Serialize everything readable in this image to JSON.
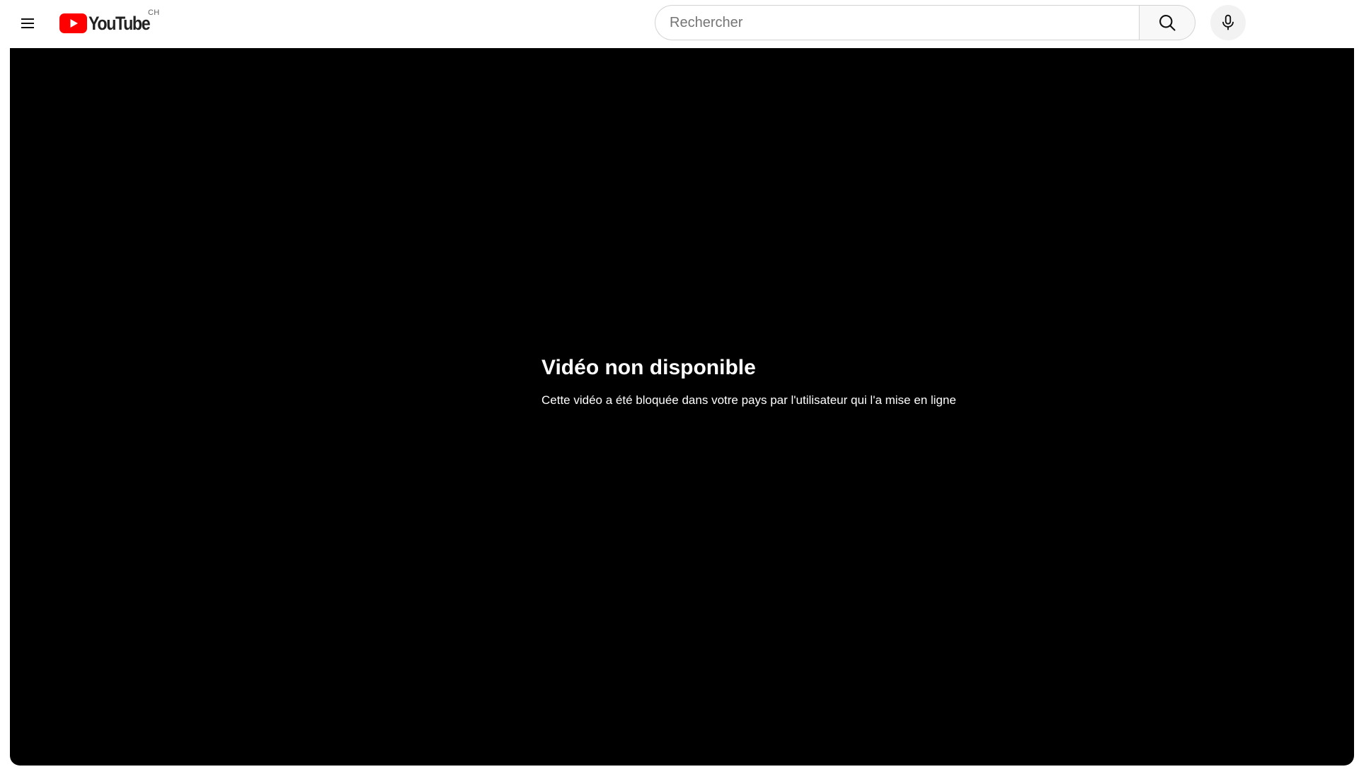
{
  "masthead": {
    "logo_text": "YouTube",
    "country_code": "CH",
    "search": {
      "placeholder": "Rechercher",
      "value": ""
    },
    "icons": {
      "menu": "hamburger-menu-icon",
      "logo": "youtube-play-icon",
      "search": "search-icon",
      "mic": "microphone-icon"
    }
  },
  "player": {
    "error": {
      "title": "Vidéo non disponible",
      "subtitle": "Cette vidéo a été bloquée dans votre pays par l'utilisateur qui l'a mise en ligne"
    }
  },
  "colors": {
    "brand_red": "#FF0000",
    "player_bg": "#000000",
    "text_dark": "#0F0F0F"
  }
}
